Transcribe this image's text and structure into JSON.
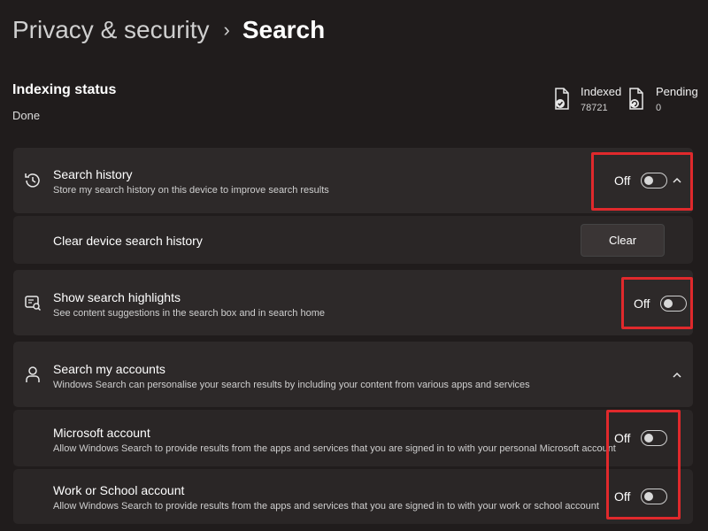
{
  "breadcrumb": {
    "parent": "Privacy & security",
    "separator": "›",
    "current": "Search"
  },
  "indexing": {
    "title": "Indexing status",
    "status": "Done",
    "indexed": {
      "label": "Indexed",
      "value": "78721",
      "icon": "document-check-icon"
    },
    "pending": {
      "label": "Pending",
      "value": "0",
      "icon": "document-sync-icon"
    }
  },
  "search_history": {
    "icon": "history-icon",
    "title": "Search history",
    "description": "Store my search history on this device to improve search results",
    "toggle_label": "Off",
    "clear_row": {
      "label": "Clear device search history",
      "button": "Clear"
    }
  },
  "search_highlights": {
    "icon": "search-highlights-icon",
    "title": "Show search highlights",
    "description": "See content suggestions in the search box and in search home",
    "toggle_label": "Off"
  },
  "search_accounts": {
    "icon": "person-icon",
    "title": "Search my accounts",
    "description": "Windows Search can personalise your search results by including your content from various apps and services",
    "microsoft": {
      "title": "Microsoft account",
      "description": "Allow Windows Search to provide results from the apps and services that you are signed in to with your personal Microsoft account",
      "toggle_label": "Off"
    },
    "work": {
      "title": "Work or School account",
      "description": "Allow Windows Search to provide results from the apps and services that you are signed in to with your work or school account",
      "toggle_label": "Off"
    }
  },
  "colors": {
    "background": "#201c1c",
    "card": "#2d2929",
    "highlight": "#e0292c"
  }
}
